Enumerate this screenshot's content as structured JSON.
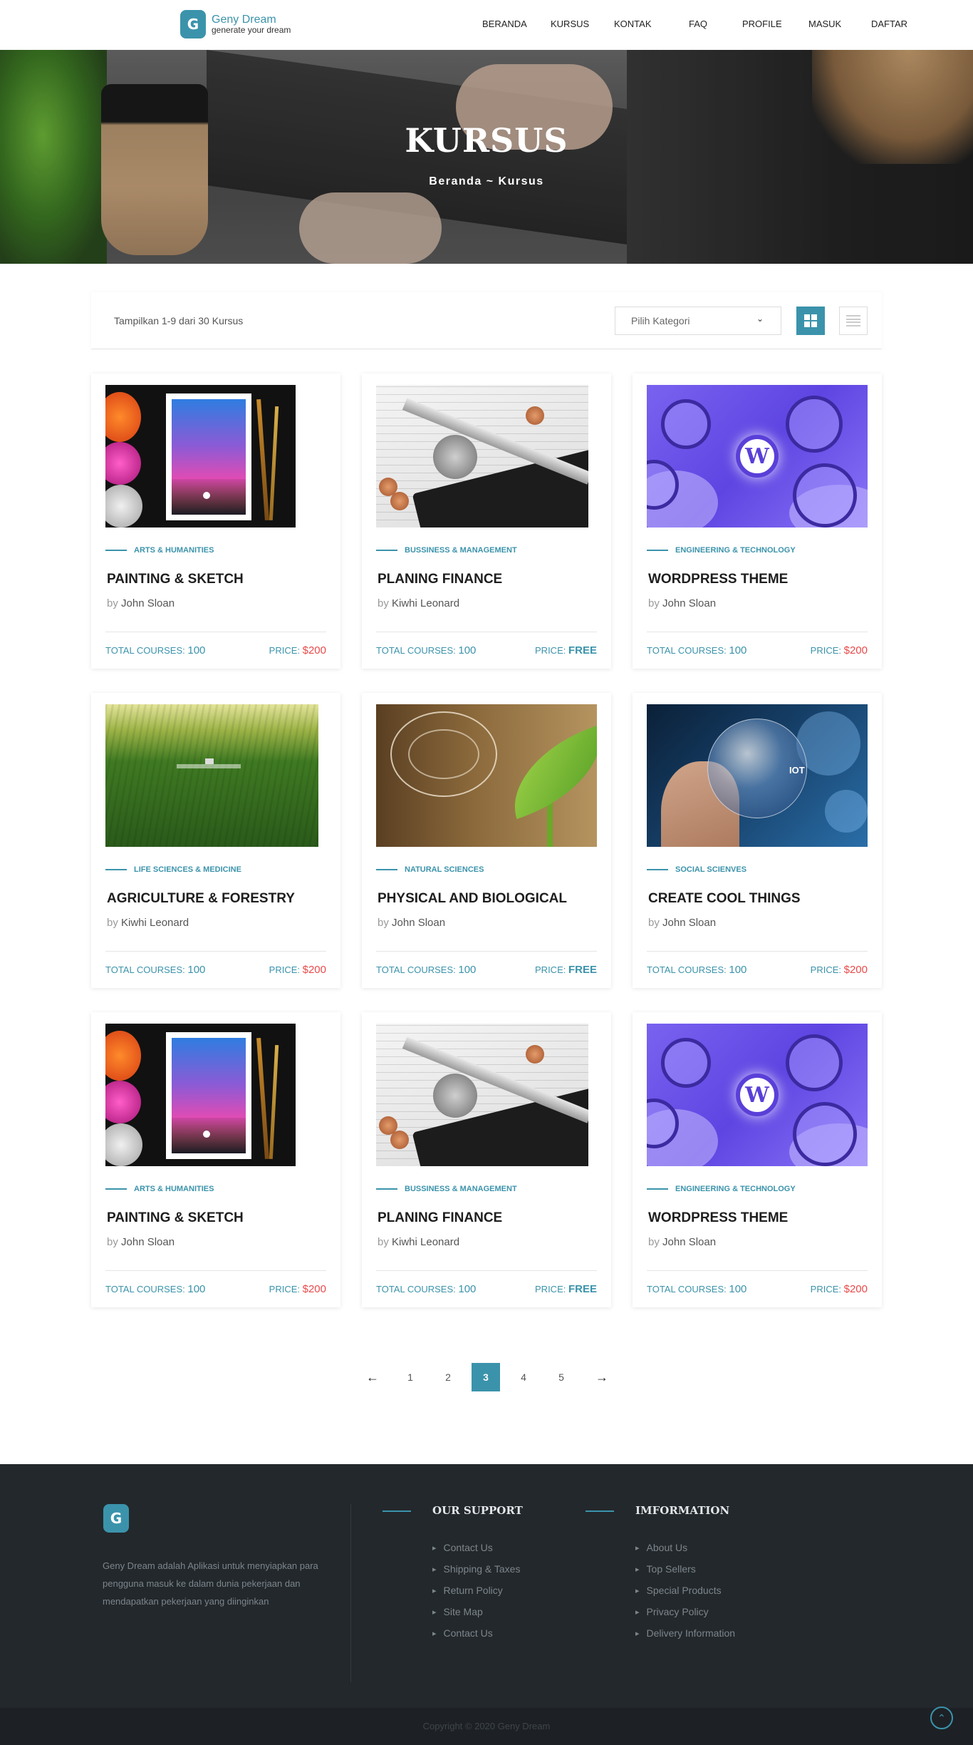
{
  "header": {
    "logo_letter": "G",
    "brand_name": "Geny Dream",
    "tagline": "generate your dream",
    "nav": [
      "BERANDA",
      "KURSUS",
      "KONTAK",
      "FAQ",
      "PROFILE",
      "MASUK",
      "DAFTAR"
    ]
  },
  "hero": {
    "title": "KURSUS",
    "breadcrumb": "Beranda ~ Kursus"
  },
  "filter": {
    "result_text": "Tampilkan 1-9 dari 30 Kursus",
    "category_select": "Pilih Kategori",
    "chevron_icon": "chevron-down-icon",
    "grid_icon": "grid-view-icon",
    "list_icon": "list-view-icon"
  },
  "card_labels": {
    "by": "by",
    "total_courses": "TOTAL COURSES:",
    "price": "PRICE:"
  },
  "courses": [
    {
      "category": "ARTS & HUMANITIES",
      "title": "PAINTING & SKETCH",
      "author": "John Sloan",
      "total": "100",
      "price": "$200",
      "image": "paint"
    },
    {
      "category": "BUSSINESS & MANAGEMENT",
      "title": "PLANING FINANCE",
      "author": "Kiwhi Leonard",
      "total": "100",
      "price": "FREE",
      "image": "finance"
    },
    {
      "category": "ENGINEERING & TECHNOLOGY",
      "title": "WORDPRESS THEME",
      "author": "John Sloan",
      "total": "100",
      "price": "$200",
      "image": "wp"
    },
    {
      "category": "LIFE SCIENCES & MEDICINE",
      "title": "AGRICULTURE & FORESTRY",
      "author": "Kiwhi Leonard",
      "total": "100",
      "price": "$200",
      "image": "agri"
    },
    {
      "category": "NATURAL SCIENCES",
      "title": "PHYSICAL AND BIOLOGICAL",
      "author": "John Sloan",
      "total": "100",
      "price": "FREE",
      "image": "bio"
    },
    {
      "category": "SOCIAL SCIENVES",
      "title": "CREATE COOL THINGS",
      "author": "John Sloan",
      "total": "100",
      "price": "$200",
      "image": "tech"
    },
    {
      "category": "ARTS & HUMANITIES",
      "title": "PAINTING & SKETCH",
      "author": "John Sloan",
      "total": "100",
      "price": "$200",
      "image": "paint"
    },
    {
      "category": "BUSSINESS & MANAGEMENT",
      "title": "PLANING FINANCE",
      "author": "Kiwhi Leonard",
      "total": "100",
      "price": "FREE",
      "image": "finance"
    },
    {
      "category": "ENGINEERING & TECHNOLOGY",
      "title": "WORDPRESS THEME",
      "author": "John Sloan",
      "total": "100",
      "price": "$200",
      "image": "wp"
    }
  ],
  "pagination": {
    "prev": "←",
    "pages": [
      "1",
      "2",
      "3",
      "4",
      "5"
    ],
    "active": "3",
    "next": "→"
  },
  "footer": {
    "logo_letter": "G",
    "about": "Geny Dream adalah Aplikasi untuk menyiapkan para pengguna masuk ke dalam dunia pekerjaan dan mendapatkan pekerjaan yang diinginkan",
    "support_title": "OUR SUPPORT",
    "support_links": [
      "Contact Us",
      "Shipping & Taxes",
      "Return Policy",
      "Site Map",
      "Contact Us"
    ],
    "info_title": "IMFORMATION",
    "info_links": [
      "About Us",
      "Top Sellers",
      "Special Products",
      "Privacy Policy",
      "Delivery Information"
    ],
    "copyright": "Copyright © 2020 Geny Dream",
    "to_top_icon": "chevron-up-icon"
  },
  "colors": {
    "accent": "#3b93ab",
    "price_red": "#e84a4a",
    "footer_bg": "#23282c"
  }
}
